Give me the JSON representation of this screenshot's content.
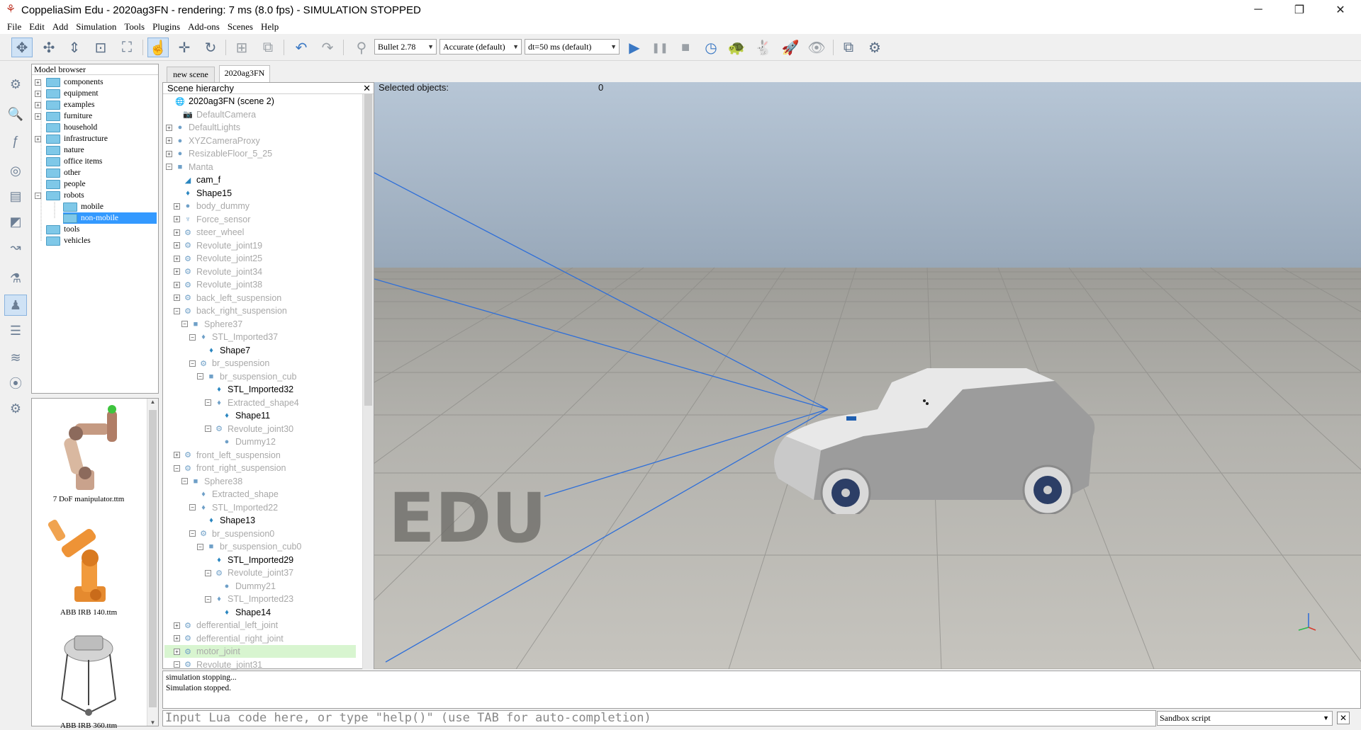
{
  "window": {
    "title": "CoppeliaSim Edu - 2020ag3FN - rendering: 7 ms (8.0 fps) - SIMULATION STOPPED",
    "app_icon": "coppeliasim-logo-icon",
    "minimize": "─",
    "maximize": "❐",
    "close": "✕"
  },
  "menu": [
    "File",
    "Edit",
    "Add",
    "Simulation",
    "Tools",
    "Plugins",
    "Add-ons",
    "Scenes",
    "Help"
  ],
  "toolbar": {
    "engine": "Bullet 2.78",
    "accuracy": "Accurate (default)",
    "timestep": "dt=50 ms (default)",
    "play_icon": "▶",
    "pause_icon": "❚❚",
    "stop_icon": "■"
  },
  "model_browser": {
    "title": "Model browser",
    "items": [
      {
        "label": "components",
        "expander": "+"
      },
      {
        "label": "equipment",
        "expander": "+"
      },
      {
        "label": "examples",
        "expander": "+"
      },
      {
        "label": "furniture",
        "expander": "+"
      },
      {
        "label": "household",
        "expander": ""
      },
      {
        "label": "infrastructure",
        "expander": "+"
      },
      {
        "label": "nature",
        "expander": ""
      },
      {
        "label": "office items",
        "expander": ""
      },
      {
        "label": "other",
        "expander": ""
      },
      {
        "label": "people",
        "expander": ""
      },
      {
        "label": "robots",
        "expander": "−"
      },
      {
        "label": "mobile",
        "expander": ""
      },
      {
        "label": "non-mobile",
        "expander": ""
      },
      {
        "label": "tools",
        "expander": ""
      },
      {
        "label": "vehicles",
        "expander": ""
      }
    ],
    "thumbnails": [
      "7 DoF manipulator.ttm",
      "ABB IRB 140.ttm",
      "ABB IRB 360.ttm"
    ]
  },
  "scene_tabs": [
    "new scene",
    "2020ag3FN"
  ],
  "hierarchy": {
    "title": "Scene hierarchy",
    "close": "✕",
    "rows": [
      {
        "label": "2020ag3FN (scene 2)",
        "exp": "",
        "icon": "🌐",
        "dim": false
      },
      {
        "label": "DefaultCamera",
        "exp": "",
        "icon": "📷",
        "dim": true
      },
      {
        "label": "DefaultLights",
        "exp": "+",
        "icon": "●",
        "dim": true
      },
      {
        "label": "XYZCameraProxy",
        "exp": "+",
        "icon": "●",
        "dim": true
      },
      {
        "label": "ResizableFloor_5_25",
        "exp": "+",
        "icon": "●",
        "dim": true
      },
      {
        "label": "Manta",
        "exp": "−",
        "icon": "■",
        "dim": true
      },
      {
        "label": "cam_f",
        "exp": "",
        "icon": "◢",
        "dim": false
      },
      {
        "label": "Shape15",
        "exp": "",
        "icon": "♦",
        "dim": false
      },
      {
        "label": "body_dummy",
        "exp": "+",
        "icon": "●",
        "dim": true
      },
      {
        "label": "Force_sensor",
        "exp": "+",
        "icon": "♆",
        "dim": true
      },
      {
        "label": "steer_wheel",
        "exp": "+",
        "icon": "⚙",
        "dim": true
      },
      {
        "label": "Revolute_joint19",
        "exp": "+",
        "icon": "⚙",
        "dim": true
      },
      {
        "label": "Revolute_joint25",
        "exp": "+",
        "icon": "⚙",
        "dim": true
      },
      {
        "label": "Revolute_joint34",
        "exp": "+",
        "icon": "⚙",
        "dim": true
      },
      {
        "label": "Revolute_joint38",
        "exp": "+",
        "icon": "⚙",
        "dim": true
      },
      {
        "label": "back_left_suspension",
        "exp": "+",
        "icon": "⚙",
        "dim": true
      },
      {
        "label": "back_right_suspension",
        "exp": "−",
        "icon": "⚙",
        "dim": true
      },
      {
        "label": "Sphere37",
        "exp": "−",
        "icon": "■",
        "dim": true
      },
      {
        "label": "STL_Imported37",
        "exp": "−",
        "icon": "♦",
        "dim": true
      },
      {
        "label": "Shape7",
        "exp": "",
        "icon": "♦",
        "dim": false
      },
      {
        "label": "br_suspension",
        "exp": "−",
        "icon": "⚙",
        "dim": true
      },
      {
        "label": "br_suspension_cub",
        "exp": "−",
        "icon": "■",
        "dim": true
      },
      {
        "label": "STL_Imported32",
        "exp": "",
        "icon": "♦",
        "dim": false
      },
      {
        "label": "Extracted_shape4",
        "exp": "−",
        "icon": "♦",
        "dim": true
      },
      {
        "label": "Shape11",
        "exp": "",
        "icon": "♦",
        "dim": false
      },
      {
        "label": "Revolute_joint30",
        "exp": "−",
        "icon": "⚙",
        "dim": true
      },
      {
        "label": "Dummy12",
        "exp": "",
        "icon": "●",
        "dim": true
      },
      {
        "label": "front_left_suspension",
        "exp": "+",
        "icon": "⚙",
        "dim": true
      },
      {
        "label": "front_right_suspension",
        "exp": "−",
        "icon": "⚙",
        "dim": true
      },
      {
        "label": "Sphere38",
        "exp": "−",
        "icon": "■",
        "dim": true
      },
      {
        "label": "Extracted_shape",
        "exp": "",
        "icon": "♦",
        "dim": true
      },
      {
        "label": "STL_Imported22",
        "exp": "−",
        "icon": "♦",
        "dim": true
      },
      {
        "label": "Shape13",
        "exp": "",
        "icon": "♦",
        "dim": false
      },
      {
        "label": "br_suspension0",
        "exp": "−",
        "icon": "⚙",
        "dim": true
      },
      {
        "label": "br_suspension_cub0",
        "exp": "−",
        "icon": "■",
        "dim": true
      },
      {
        "label": "STL_Imported29",
        "exp": "",
        "icon": "♦",
        "dim": false
      },
      {
        "label": "Revolute_joint37",
        "exp": "−",
        "icon": "⚙",
        "dim": true
      },
      {
        "label": "Dummy21",
        "exp": "",
        "icon": "●",
        "dim": true
      },
      {
        "label": "STL_Imported23",
        "exp": "−",
        "icon": "♦",
        "dim": true
      },
      {
        "label": "Shape14",
        "exp": "",
        "icon": "♦",
        "dim": false
      },
      {
        "label": "defferential_left_joint",
        "exp": "+",
        "icon": "⚙",
        "dim": true
      },
      {
        "label": "defferential_right_joint",
        "exp": "+",
        "icon": "⚙",
        "dim": true
      },
      {
        "label": "motor_joint",
        "exp": "+",
        "icon": "⚙",
        "dim": true
      },
      {
        "label": "Revolute_joint31",
        "exp": "−",
        "icon": "⚙",
        "dim": true
      }
    ]
  },
  "viewport": {
    "selected_label": "Selected objects:",
    "selected_count": "0",
    "watermark": "EDU"
  },
  "console": {
    "lines": [
      "simulation stopping...",
      "Simulation stopped."
    ],
    "input_placeholder": "Input Lua code here, or type \"help()\" (use TAB for auto-completion)",
    "script_select": "Sandbox script"
  },
  "colors": {
    "selection": "#3399ff",
    "hierarchy_highlight": "#d8f5d0",
    "sky_top": "#b7c6d6",
    "floor": "#b3b2ad",
    "ray": "#2f6fd8"
  }
}
